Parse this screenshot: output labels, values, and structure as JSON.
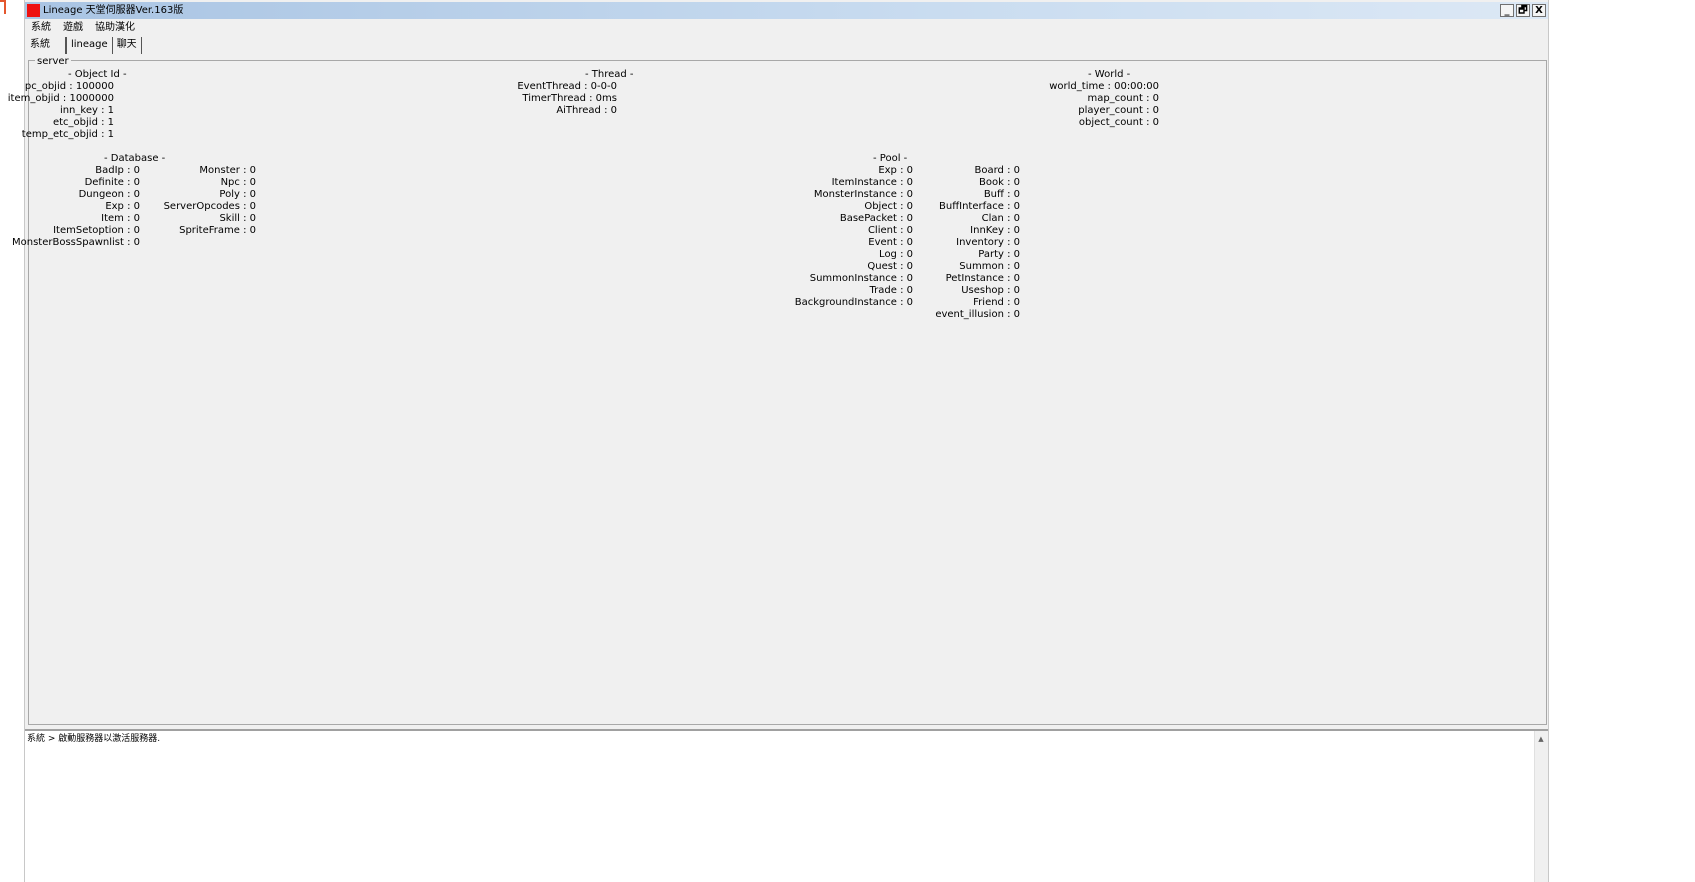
{
  "window": {
    "title": "Lineage 天堂伺服器Ver.163版",
    "buttons": {
      "minimize": "_",
      "restore": "🗗",
      "close": "X"
    }
  },
  "menu": [
    "系統",
    "遊戲",
    "協助漢化"
  ],
  "tabs": [
    "系統",
    "lineage",
    "聊天"
  ],
  "server_group": {
    "legend": "server",
    "object_id": {
      "title": "- Object Id -",
      "items": [
        "pc_objid : 100000",
        "item_objid : 1000000",
        "inn_key : 1",
        "etc_objid : 1",
        "temp_etc_objid : 1"
      ]
    },
    "thread": {
      "title": "- Thread -",
      "items": [
        "EventThread : 0-0-0",
        "TimerThread : 0ms",
        "AiThread : 0"
      ]
    },
    "world": {
      "title": "- World -",
      "items": [
        "world_time : 00:00:00",
        "map_count : 0",
        "player_count : 0",
        "object_count : 0"
      ]
    },
    "database": {
      "title": "- Database -",
      "col1": [
        "BadIp : 0",
        "Definite : 0",
        "Dungeon : 0",
        "Exp : 0",
        "Item : 0",
        "ItemSetoption : 0",
        "MonsterBossSpawnlist : 0"
      ],
      "col2": [
        "Monster : 0",
        "Npc : 0",
        "Poly : 0",
        "ServerOpcodes : 0",
        "Skill : 0",
        "SpriteFrame : 0"
      ]
    },
    "pool": {
      "title": "- Pool -",
      "col1": [
        "Exp : 0",
        "ItemInstance : 0",
        "MonsterInstance : 0",
        "Object : 0",
        "BasePacket : 0",
        "Client : 0",
        "Event : 0",
        "Log : 0",
        "Quest : 0",
        "SummonInstance : 0",
        "Trade : 0",
        "BackgroundInstance : 0"
      ],
      "col2": [
        "Board : 0",
        "Book : 0",
        "Buff : 0",
        "BuffInterface : 0",
        "Clan : 0",
        "InnKey : 0",
        "Inventory : 0",
        "Party : 0",
        "Summon : 0",
        "PetInstance : 0",
        "Useshop : 0",
        "Friend : 0",
        "event_illusion : 0"
      ]
    }
  },
  "console": {
    "line": "系統 > 啟動服務器以激活服務器.",
    "scroll_up": "▲"
  }
}
